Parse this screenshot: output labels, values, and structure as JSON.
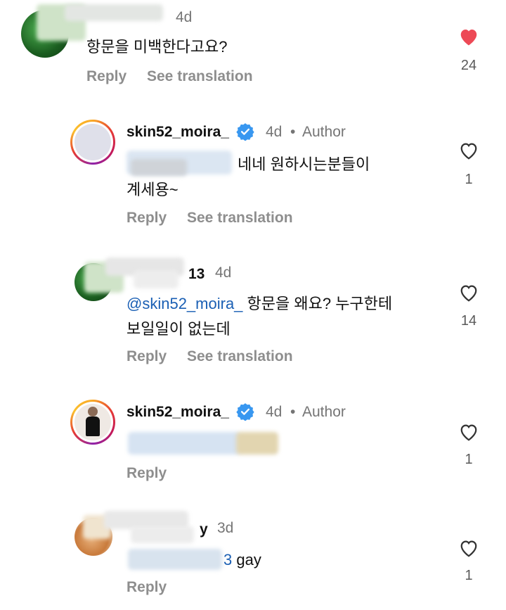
{
  "comments": [
    {
      "time": "4d",
      "text": "항문을 미백한다고요?",
      "reply": "Reply",
      "see_translation": "See translation",
      "likes": "24",
      "liked": true
    },
    {
      "username": "skin52_moira_",
      "time": "4d",
      "dot": "•",
      "author": "Author",
      "text_line1": "네네 원하시는분들이",
      "text_line2": "계세용~",
      "reply": "Reply",
      "see_translation": "See translation",
      "likes": "1"
    },
    {
      "username_tail": "13",
      "time": "4d",
      "mention": "@skin52_moira_",
      "text_line1": " 항문을 왜요? 누구한테",
      "text_line2": "보일일이 없는데",
      "reply": "Reply",
      "see_translation": "See translation",
      "likes": "14"
    },
    {
      "username": "skin52_moira_",
      "time": "4d",
      "dot": "•",
      "author": "Author",
      "reply": "Reply",
      "likes": "1"
    },
    {
      "username_tail": "y",
      "time": "3d",
      "mention_tail": "3",
      "text": " gay",
      "reply": "Reply",
      "likes": "1"
    }
  ],
  "colors": {
    "heart_liked": "#ed4956",
    "verified": "#3897f0",
    "mention": "#1a5fb4"
  }
}
